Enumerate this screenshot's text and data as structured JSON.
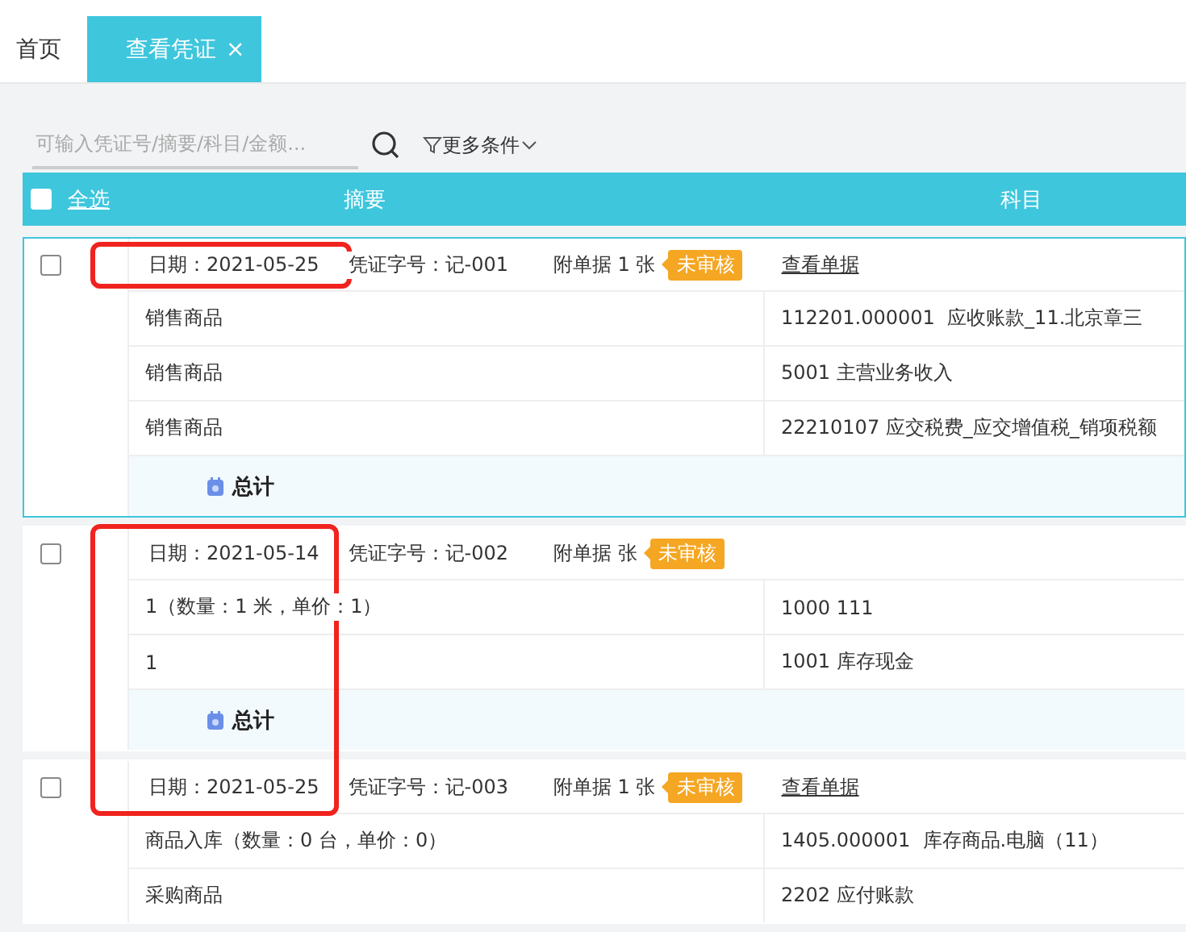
{
  "tabs": [
    {
      "label": "首页",
      "selected": false
    },
    {
      "label": "查看凭证",
      "selected": true,
      "close": "×"
    }
  ],
  "search": {
    "placeholder": "可输入凭证号/摘要/科目/金额..."
  },
  "filter": {
    "label": "更多条件"
  },
  "table": {
    "select_all": {
      "label": "全选",
      "checked": false
    },
    "columns": [
      "摘要",
      "科目"
    ]
  },
  "vouchers": [
    {
      "selected": true,
      "checked": false,
      "date": "日期：2021-05-25",
      "number": "凭证字号：记-001",
      "attachments": "附单据 1 张",
      "status": "未审核",
      "link": "查看单据",
      "highlight": true,
      "highlight_continues": false,
      "rows": [
        {
          "summary": "销售商品",
          "account": "112201.000001  应收账款_11.北京章三"
        },
        {
          "summary": "销售商品",
          "account": "5001 主营业务收入"
        },
        {
          "summary": "销售商品",
          "account": "22210107 应交税费_应交增值税_销项税额"
        }
      ],
      "total": "总计"
    },
    {
      "selected": false,
      "checked": false,
      "date": "日期：2021-05-14",
      "number": "凭证字号：记-002",
      "attachments": "附单据  张",
      "status": "未审核",
      "highlight": true,
      "highlight_continues": true,
      "rows": [
        {
          "summary": "1（数量：1 米，单价：1）",
          "account": "1000 111"
        },
        {
          "summary": "1",
          "account": "1001 库存现金"
        }
      ],
      "total": "总计"
    },
    {
      "selected": false,
      "checked": false,
      "date": "日期：2021-05-25",
      "number": "凭证字号：记-003",
      "attachments": "附单据 1 张",
      "status": "未审核",
      "link": "查看单据",
      "highlight": true,
      "highlight_continues": false,
      "rows": [
        {
          "summary": "商品入库（数量：0 台，单价：0）",
          "account": "1405.000001  库存商品.电脑（11）"
        },
        {
          "summary": "采购商品",
          "account": "2202 应付账款"
        }
      ]
    }
  ]
}
